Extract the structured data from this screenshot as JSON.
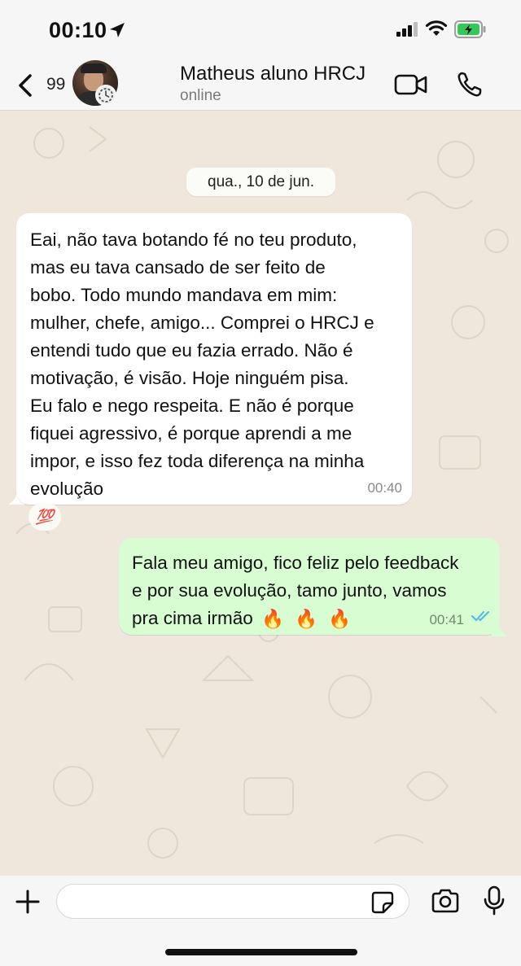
{
  "status_bar": {
    "time": "00:10",
    "icons": [
      "location-arrow-icon",
      "signal-icon",
      "wifi-icon",
      "battery-charging-icon"
    ]
  },
  "header": {
    "back_icon": "chevron-left-icon",
    "unread_count": "99",
    "contact_name": "Matheus aluno HRCJ",
    "contact_status": "online",
    "actions": [
      "video-call-icon",
      "phone-icon"
    ]
  },
  "chat": {
    "date_separator": "qua., 10 de jun.",
    "messages": [
      {
        "direction": "incoming",
        "text": "Eai, não tava botando fé no teu produto,\nmas eu tava cansado de ser feito de\nbobo. Todo mundo mandava em mim:\nmulher, chefe, amigo... Comprei o HRCJ e\nentendi tudo que eu fazia errado. Não é\nmotivação, é visão. Hoje ninguém pisa.\nEu falo e nego respeita. E não é porque\nfiquei agressivo, é porque aprendi a me\nimpor, e isso fez toda diferença na minha\nevolução",
        "time": "00:40",
        "reaction": "💯"
      },
      {
        "direction": "outgoing",
        "text_line1": "Fala meu amigo, fico feliz pelo feedback",
        "text_line2": "e por sua evolução, tamo junto, vamos",
        "text_line3": "pra cima irmão",
        "emojis": [
          "🔥",
          "🔥",
          "🔥"
        ],
        "time": "00:41",
        "status": "read"
      }
    ]
  },
  "input_bar": {
    "placeholder": "",
    "value": "",
    "icons": [
      "plus-icon",
      "sticker-icon",
      "camera-icon",
      "microphone-icon"
    ]
  },
  "colors": {
    "wallpaper": "#efe7dc",
    "incoming_bubble": "#ffffff",
    "outgoing_bubble": "#d8fdd2",
    "read_ticks": "#4fb6ec",
    "battery": "#34c759"
  }
}
